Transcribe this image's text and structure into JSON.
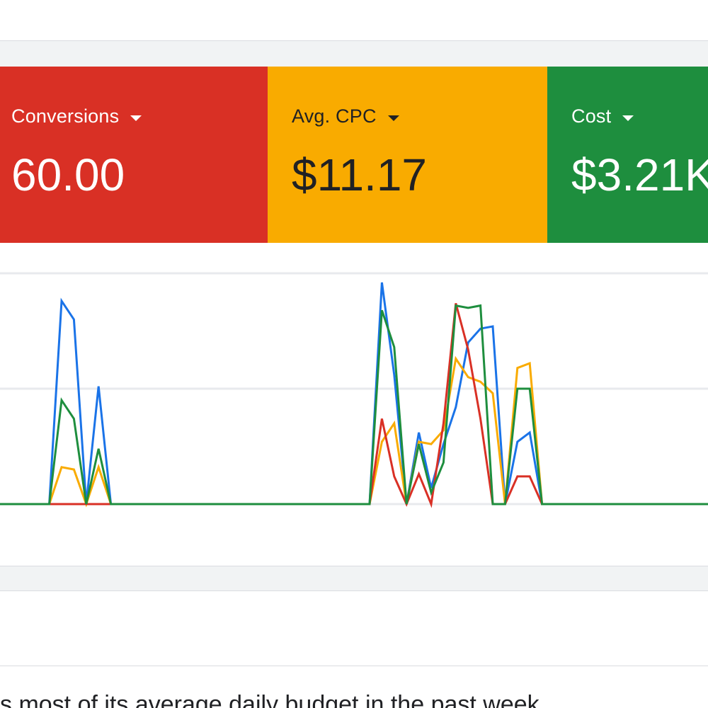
{
  "metrics": [
    {
      "label": "Conversions",
      "value": "60.00",
      "bg": "#d93025",
      "fg": "#ffffff"
    },
    {
      "label": "Avg. CPC",
      "value": "$11.17",
      "bg": "#f9ab00",
      "fg": "#202124"
    },
    {
      "label": "Cost",
      "value": "$3.21K",
      "bg": "#1e8e3e",
      "fg": "#ffffff"
    }
  ],
  "message": "s most of its average daily budget in the past week",
  "chart_data": {
    "type": "line",
    "x": [
      0,
      1,
      2,
      3,
      4,
      5,
      6,
      7,
      8,
      9,
      10,
      11,
      12,
      13,
      14,
      15,
      16,
      17,
      18,
      19,
      20,
      21,
      22,
      23,
      24,
      25,
      26,
      27,
      28,
      29,
      30,
      31,
      32,
      33,
      34,
      35,
      36,
      37,
      38,
      39,
      40,
      41,
      42,
      43,
      44,
      45,
      46,
      47,
      48,
      49,
      50,
      51,
      52,
      53,
      54,
      55,
      56,
      57,
      58,
      59
    ],
    "ylim": [
      0,
      100
    ],
    "grid": true,
    "series": [
      {
        "color": "#1a73e8",
        "values": [
          0,
          0,
          0,
          0,
          0,
          88,
          80,
          0,
          51,
          0,
          0,
          0,
          0,
          0,
          0,
          0,
          0,
          0,
          0,
          0,
          0,
          0,
          0,
          0,
          0,
          0,
          0,
          0,
          0,
          0,
          0,
          96,
          56,
          0,
          31,
          7,
          26,
          42,
          70,
          76,
          77,
          0,
          27,
          31,
          0,
          0,
          0,
          0,
          0,
          0,
          0,
          0,
          0,
          0,
          0,
          0,
          0,
          0,
          0,
          0
        ]
      },
      {
        "color": "#f9ab00",
        "values": [
          0,
          0,
          0,
          0,
          0,
          16,
          15,
          0,
          16,
          0,
          0,
          0,
          0,
          0,
          0,
          0,
          0,
          0,
          0,
          0,
          0,
          0,
          0,
          0,
          0,
          0,
          0,
          0,
          0,
          0,
          0,
          27,
          35,
          0,
          27,
          26,
          32,
          63,
          55,
          53,
          48,
          0,
          59,
          61,
          0,
          0,
          0,
          0,
          0,
          0,
          0,
          0,
          0,
          0,
          0,
          0,
          0,
          0,
          0,
          0
        ]
      },
      {
        "color": "#d93025",
        "values": [
          0,
          0,
          0,
          0,
          0,
          0,
          0,
          0,
          0,
          0,
          0,
          0,
          0,
          0,
          0,
          0,
          0,
          0,
          0,
          0,
          0,
          0,
          0,
          0,
          0,
          0,
          0,
          0,
          0,
          0,
          0,
          37,
          12,
          0,
          13,
          0,
          35,
          87,
          67,
          37,
          0,
          0,
          12,
          12,
          0,
          0,
          0,
          0,
          0,
          0,
          0,
          0,
          0,
          0,
          0,
          0,
          0,
          0,
          0,
          0
        ]
      },
      {
        "color": "#1e8e3e",
        "values": [
          0,
          0,
          0,
          0,
          0,
          45,
          37,
          0,
          24,
          0,
          0,
          0,
          0,
          0,
          0,
          0,
          0,
          0,
          0,
          0,
          0,
          0,
          0,
          0,
          0,
          0,
          0,
          0,
          0,
          0,
          0,
          84,
          68,
          0,
          26,
          5,
          18,
          86,
          85,
          86,
          0,
          0,
          50,
          50,
          0,
          0,
          0,
          0,
          0,
          0,
          0,
          0,
          0,
          0,
          0,
          0,
          0,
          0,
          0,
          0
        ]
      }
    ]
  }
}
